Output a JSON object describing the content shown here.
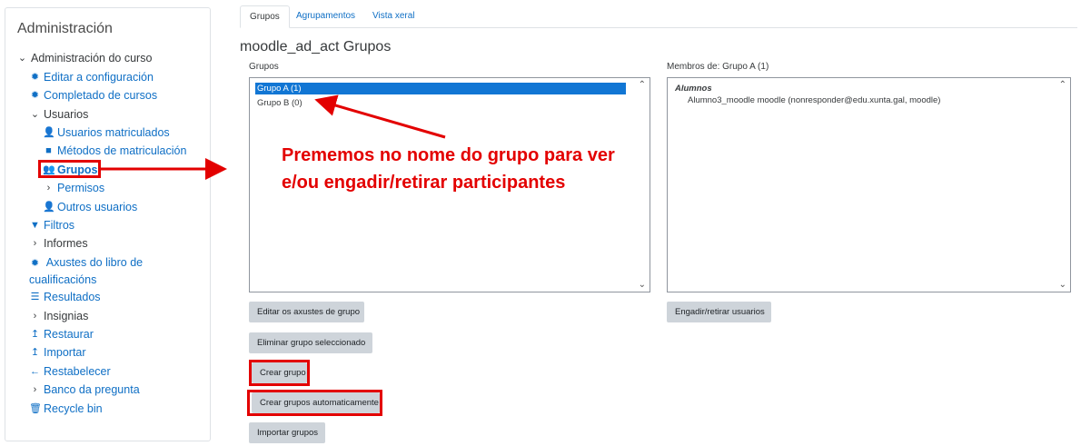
{
  "sidebar": {
    "title": "Administración",
    "items": [
      {
        "label": "Administración do curso",
        "kind": "plain",
        "icon": "chevron-down-icon"
      },
      {
        "label": "Editar a configuración",
        "kind": "link",
        "icon": "gear-icon"
      },
      {
        "label": "Completado de cursos",
        "kind": "link",
        "icon": "gear-icon"
      },
      {
        "label": "Usuarios",
        "kind": "plain",
        "icon": "chevron-down-icon"
      },
      {
        "label": "Usuarios matriculados",
        "kind": "link",
        "icon": "user-plus-icon"
      },
      {
        "label": "Métodos de matriculación",
        "kind": "link",
        "icon": "square-icon"
      },
      {
        "label": "Grupos",
        "kind": "link",
        "icon": "users-icon"
      },
      {
        "label": "Permisos",
        "kind": "link",
        "icon": "chevron-right-icon"
      },
      {
        "label": "Outros usuarios",
        "kind": "link",
        "icon": "user-plus-icon"
      },
      {
        "label": "Filtros",
        "kind": "link",
        "icon": "filter-icon"
      },
      {
        "label": "Informes",
        "kind": "plain",
        "icon": "chevron-right-icon"
      },
      {
        "label": "Axustes do libro de cualificacións",
        "kind": "link",
        "icon": "gear-icon"
      },
      {
        "label": "Resultados",
        "kind": "link",
        "icon": "list-icon"
      },
      {
        "label": "Insignias",
        "kind": "plain",
        "icon": "chevron-right-icon"
      },
      {
        "label": "Restaurar",
        "kind": "link",
        "icon": "upload-icon"
      },
      {
        "label": "Importar",
        "kind": "link",
        "icon": "upload-icon"
      },
      {
        "label": "Restabelecer",
        "kind": "link",
        "icon": "arrow-left-icon"
      },
      {
        "label": "Banco da pregunta",
        "kind": "plain",
        "icon": "chevron-right-icon"
      },
      {
        "label": "Recycle bin",
        "kind": "link",
        "icon": "trash-icon"
      }
    ]
  },
  "tabs": [
    {
      "label": "Grupos",
      "active": true
    },
    {
      "label": "Agrupamentos",
      "active": false
    },
    {
      "label": "Vista xeral",
      "active": false
    }
  ],
  "page_title": "moodle_ad_act Grupos",
  "groups": {
    "label": "Grupos",
    "options": [
      {
        "label": "Grupo A (1)",
        "selected": true
      },
      {
        "label": "Grupo B (0)",
        "selected": false
      }
    ]
  },
  "members": {
    "label": "Membros de: Grupo A (1)",
    "role_heading": "Alumnos",
    "entries": [
      "Alumno3_moodle moodle (nonresponder@edu.xunta.gal, moodle)"
    ]
  },
  "buttons": {
    "edit_group": "Editar os axustes de grupo",
    "delete_group": "Eliminar grupo seleccionado",
    "create_group": "Crear grupo",
    "auto_create": "Crear grupos automaticamente",
    "import_groups": "Importar grupos",
    "add_remove_users": "Engadir/retirar usuarios"
  },
  "annotation": {
    "line1": "Prememos no nome do grupo para ver",
    "line2": "e/ou engadir/retirar participantes",
    "color": "#e30000"
  },
  "colors": {
    "link": "#0f6fc5",
    "selected": "#1176d4",
    "button": "#ced4da"
  }
}
